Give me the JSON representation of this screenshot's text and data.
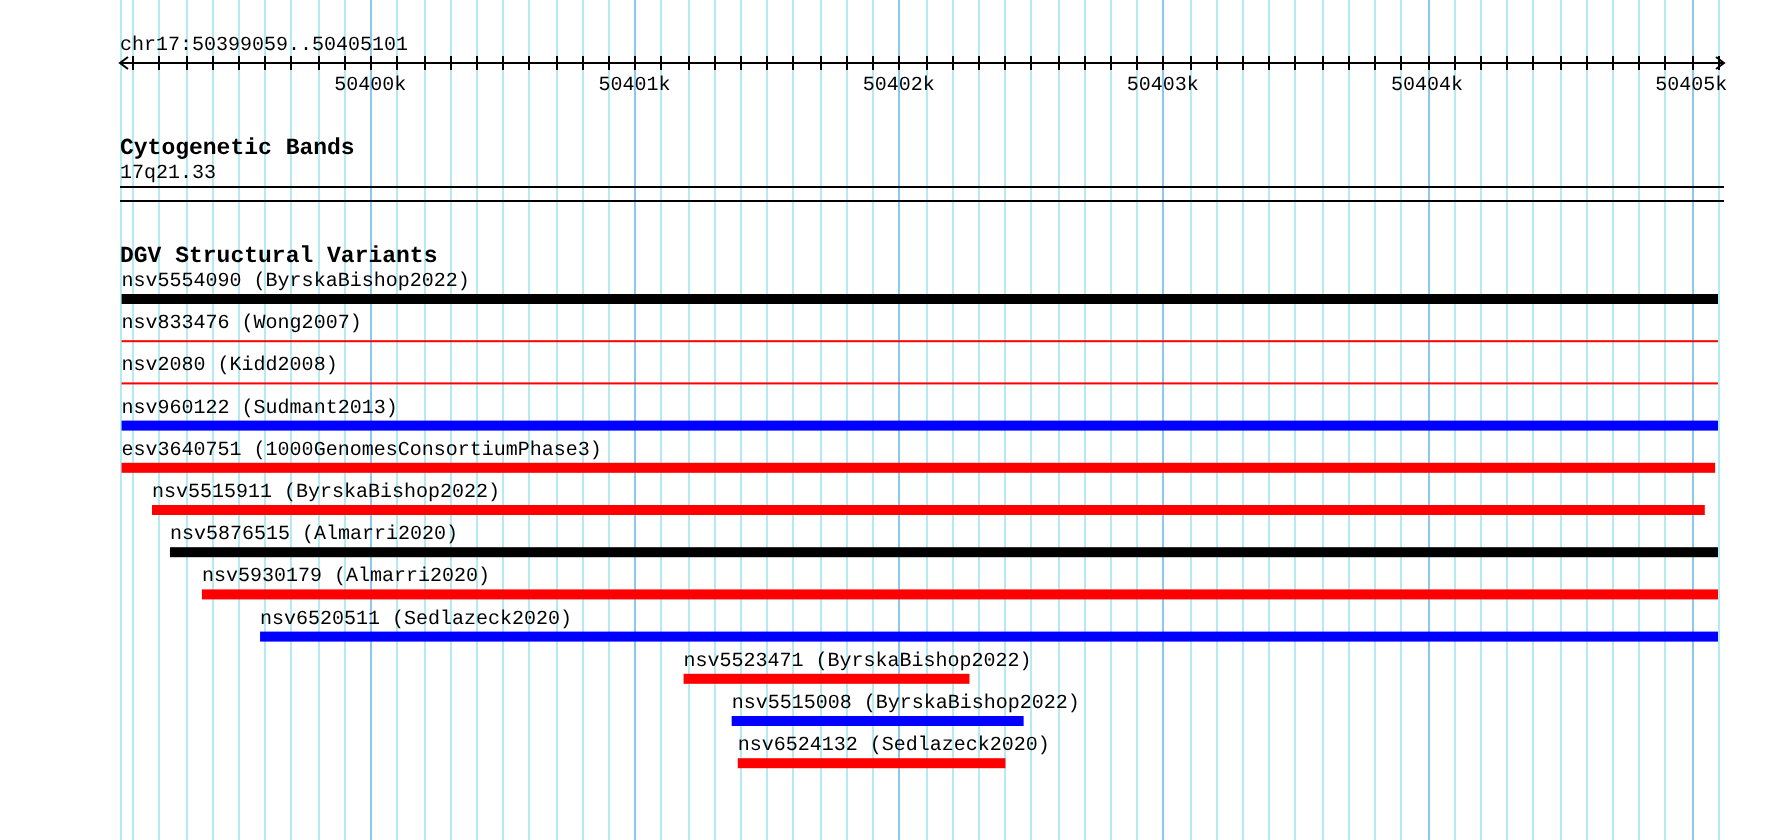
{
  "ruler": {
    "region": "chr17:50399059..50405101",
    "tick_labels": [
      "50400k",
      "50401k",
      "50402k",
      "50403k",
      "50404k",
      "50405k"
    ]
  },
  "cytogenetic_bands": {
    "title": "Cytogenetic Bands",
    "band": "17q21.33"
  },
  "structural_variants": {
    "title": "DGV Structural Variants",
    "features": [
      {
        "label": "nsv5554090 (ByrskaBishop2022)",
        "kind": "bar",
        "color": "#000000"
      },
      {
        "label": "nsv833476 (Wong2007)",
        "kind": "line",
        "color": "#ff0000"
      },
      {
        "label": "nsv2080 (Kidd2008)",
        "kind": "line",
        "color": "#ff0000"
      },
      {
        "label": "nsv960122 (Sudmant2013)",
        "kind": "bar",
        "color": "#0000ff"
      },
      {
        "label": "esv3640751 (1000GenomesConsortiumPhase3)",
        "kind": "bar",
        "color": "#ff0000"
      },
      {
        "label": "nsv5515911 (ByrskaBishop2022)",
        "kind": "bar",
        "color": "#ff0000"
      },
      {
        "label": "nsv5876515 (Almarri2020)",
        "kind": "bar",
        "color": "#000000"
      },
      {
        "label": "nsv5930179 (Almarri2020)",
        "kind": "bar",
        "color": "#ff0000"
      },
      {
        "label": "nsv6520511 (Sedlazeck2020)",
        "kind": "bar",
        "color": "#0000ff"
      },
      {
        "label": "nsv5523471 (ByrskaBishop2022)",
        "kind": "bar",
        "color": "#ff0000"
      },
      {
        "label": "nsv5515008 (ByrskaBishop2022)",
        "kind": "bar",
        "color": "#0000ff"
      },
      {
        "label": "nsv6524132 (Sedlazeck2020)",
        "kind": "bar",
        "color": "#ff0000"
      }
    ]
  }
}
